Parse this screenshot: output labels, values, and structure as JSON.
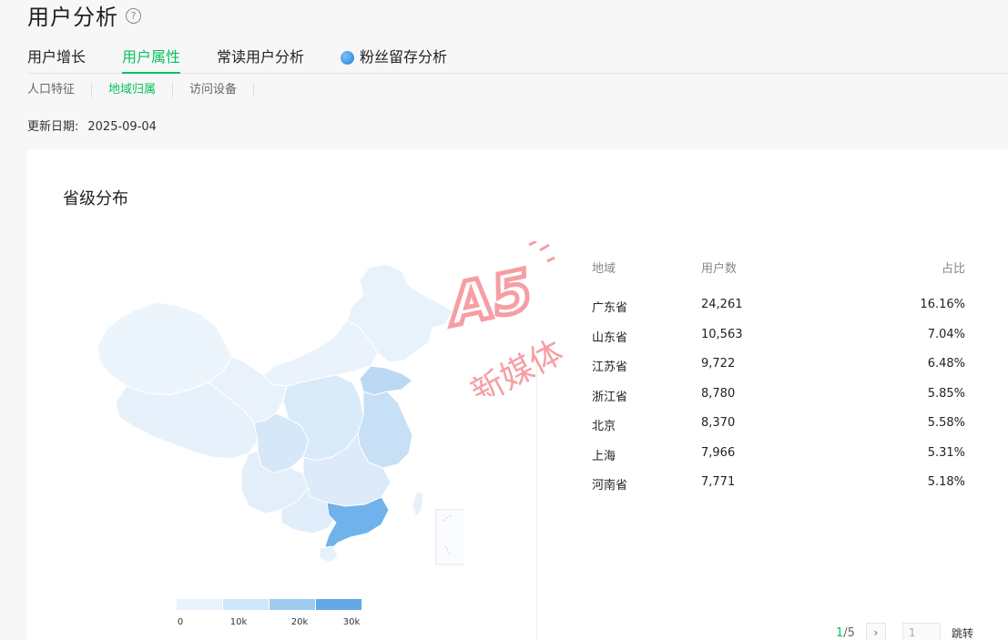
{
  "header": {
    "title": "用户分析",
    "help": "?"
  },
  "main_tabs": [
    {
      "label": "用户增长",
      "active": false
    },
    {
      "label": "用户属性",
      "active": true
    },
    {
      "label": "常读用户分析",
      "active": false
    },
    {
      "label": "粉丝留存分析",
      "active": false,
      "icon": "water-drop-icon"
    }
  ],
  "sub_tabs": [
    {
      "label": "人口特征",
      "active": false
    },
    {
      "label": "地域归属",
      "active": true
    },
    {
      "label": "访问设备",
      "active": false
    }
  ],
  "update": {
    "label": "更新日期:",
    "date": "2025-09-04"
  },
  "card": {
    "title": "省级分布"
  },
  "legend": {
    "labels": [
      "0",
      "10k",
      "20k",
      "30k"
    ],
    "colors": [
      "#e8f3fd",
      "#cfe5f9",
      "#9fcbf1",
      "#64a8e8"
    ]
  },
  "table": {
    "headers": [
      "地域",
      "用户数",
      "占比"
    ],
    "rows": [
      {
        "region": "广东省",
        "users": "24,261",
        "ratio": "16.16%"
      },
      {
        "region": "山东省",
        "users": "10,563",
        "ratio": "7.04%"
      },
      {
        "region": "江苏省",
        "users": "9,722",
        "ratio": "6.48%"
      },
      {
        "region": "浙江省",
        "users": "8,780",
        "ratio": "5.85%"
      },
      {
        "region": "北京",
        "users": "8,370",
        "ratio": "5.58%"
      },
      {
        "region": "上海",
        "users": "7,966",
        "ratio": "5.31%"
      },
      {
        "region": "河南省",
        "users": "7,771",
        "ratio": "5.18%"
      }
    ]
  },
  "pager": {
    "current": "1",
    "sep": " / ",
    "total": "5",
    "next": "›",
    "input_value": "1",
    "jump_label": "跳转"
  },
  "watermark": {
    "line1": "A5",
    "line2": "新媒体"
  },
  "colors": {
    "accent": "#07c160",
    "map_base": "#e6f1fb",
    "map_high": "#6fb2ec"
  }
}
